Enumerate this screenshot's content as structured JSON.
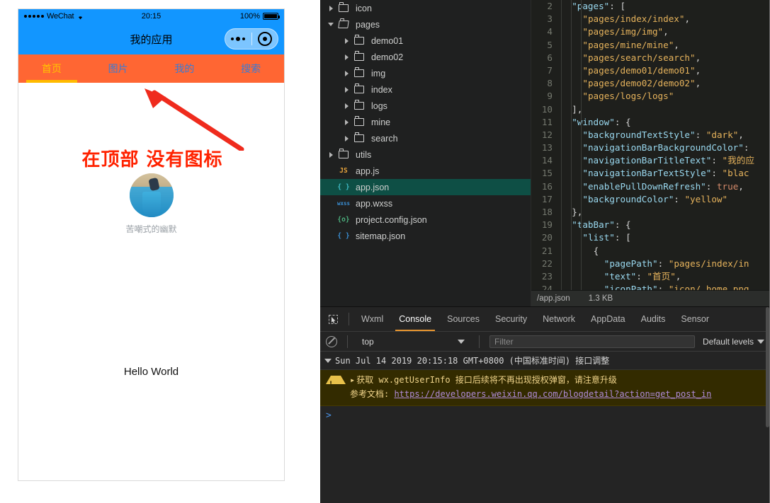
{
  "simulator": {
    "status_bar": {
      "carrier": "WeChat",
      "time": "20:15",
      "battery_percent": "100%"
    },
    "nav": {
      "title": "我的应用"
    },
    "tabs": [
      {
        "label": "首页",
        "active": true
      },
      {
        "label": "图片",
        "active": false
      },
      {
        "label": "我的",
        "active": false
      },
      {
        "label": "搜索",
        "active": false
      }
    ],
    "annotation": "在顶部 没有图标",
    "avatar_caption": "苦嘲式的幽默",
    "hello_text": "Hello World",
    "colors": {
      "nav_bg": "#1296ff",
      "tabbar_bg": "#ff6633",
      "tab_active": "#ffc400",
      "tab_inactive": "#3a7bd5",
      "annotation": "#ff2200"
    }
  },
  "ide": {
    "file_tree": [
      {
        "indent": 0,
        "twisty": "closed",
        "icon": "folder-icon",
        "name": "icon",
        "selected": false
      },
      {
        "indent": 0,
        "twisty": "open",
        "icon": "folder-open-icon",
        "name": "pages",
        "selected": false
      },
      {
        "indent": 1,
        "twisty": "closed",
        "icon": "folder-icon",
        "name": "demo01",
        "selected": false
      },
      {
        "indent": 1,
        "twisty": "closed",
        "icon": "folder-icon",
        "name": "demo02",
        "selected": false
      },
      {
        "indent": 1,
        "twisty": "closed",
        "icon": "folder-icon",
        "name": "img",
        "selected": false
      },
      {
        "indent": 1,
        "twisty": "closed",
        "icon": "folder-icon",
        "name": "index",
        "selected": false
      },
      {
        "indent": 1,
        "twisty": "closed",
        "icon": "folder-icon",
        "name": "logs",
        "selected": false
      },
      {
        "indent": 1,
        "twisty": "closed",
        "icon": "folder-icon",
        "name": "mine",
        "selected": false
      },
      {
        "indent": 1,
        "twisty": "closed",
        "icon": "folder-icon",
        "name": "search",
        "selected": false
      },
      {
        "indent": 0,
        "twisty": "closed",
        "icon": "folder-icon",
        "name": "utils",
        "selected": false
      },
      {
        "indent": 0,
        "twisty": "none",
        "icon": "js-file-icon",
        "ext": "JS",
        "name": "app.js",
        "selected": false
      },
      {
        "indent": 0,
        "twisty": "none",
        "icon": "json-file-icon",
        "ext": "{ }",
        "name": "app.json",
        "selected": true
      },
      {
        "indent": 0,
        "twisty": "none",
        "icon": "wxss-file-icon",
        "ext": "wxss",
        "name": "app.wxss",
        "selected": false
      },
      {
        "indent": 0,
        "twisty": "none",
        "icon": "config-file-icon",
        "ext": "{o}",
        "name": "project.config.json",
        "selected": false
      },
      {
        "indent": 0,
        "twisty": "none",
        "icon": "json-file-icon",
        "ext": "{ }",
        "name": "sitemap.json",
        "selected": false
      }
    ],
    "code_lines": [
      {
        "no": "2",
        "text": "  \"pages\": ["
      },
      {
        "no": "3",
        "text": "    \"pages/index/index\","
      },
      {
        "no": "4",
        "text": "    \"pages/img/img\","
      },
      {
        "no": "5",
        "text": "    \"pages/mine/mine\","
      },
      {
        "no": "6",
        "text": "    \"pages/search/search\","
      },
      {
        "no": "7",
        "text": "    \"pages/demo01/demo01\","
      },
      {
        "no": "8",
        "text": "    \"pages/demo02/demo02\","
      },
      {
        "no": "9",
        "text": "    \"pages/logs/logs\""
      },
      {
        "no": "10",
        "text": "  ],"
      },
      {
        "no": "11",
        "text": "  \"window\": {"
      },
      {
        "no": "12",
        "text": "    \"backgroundTextStyle\": \"dark\","
      },
      {
        "no": "13",
        "text": "    \"navigationBarBackgroundColor\":"
      },
      {
        "no": "14",
        "text": "    \"navigationBarTitleText\": \"我的应"
      },
      {
        "no": "15",
        "text": "    \"navigationBarTextStyle\": \"blac"
      },
      {
        "no": "16",
        "text": "    \"enablePullDownRefresh\": true,"
      },
      {
        "no": "17",
        "text": "    \"backgroundColor\": \"yellow\""
      },
      {
        "no": "18",
        "text": "  },"
      },
      {
        "no": "19",
        "text": "  \"tabBar\": {"
      },
      {
        "no": "20",
        "text": "    \"list\": ["
      },
      {
        "no": "21",
        "text": "      {"
      },
      {
        "no": "22",
        "text": "        \"pagePath\": \"pages/index/in"
      },
      {
        "no": "23",
        "text": "        \"text\": \"首页\","
      },
      {
        "no": "24",
        "text": "        \"iconPath\": \"icon/_home.png"
      }
    ],
    "editor_status": {
      "file_path": "/app.json",
      "file_size": "1.3 KB"
    },
    "devtools": {
      "tabs": [
        {
          "label": "Wxml",
          "active": false
        },
        {
          "label": "Console",
          "active": true
        },
        {
          "label": "Sources",
          "active": false
        },
        {
          "label": "Security",
          "active": false
        },
        {
          "label": "Network",
          "active": false
        },
        {
          "label": "AppData",
          "active": false
        },
        {
          "label": "Audits",
          "active": false
        },
        {
          "label": "Sensor",
          "active": false
        }
      ],
      "filter_bar": {
        "context": "top",
        "filter_placeholder": "Filter",
        "levels": "Default levels"
      },
      "console": {
        "group_header": "Sun Jul 14 2019 20:15:18 GMT+0800 (中国标准时间) 接口调整",
        "warning_line1": "获取 wx.getUserInfo 接口后续将不再出现授权弹窗，请注意升级",
        "warning_label": "参考文档: ",
        "warning_link": "https://developers.weixin.qq.com/blogdetail?action=get_post_in",
        "prompt": ">"
      }
    }
  }
}
